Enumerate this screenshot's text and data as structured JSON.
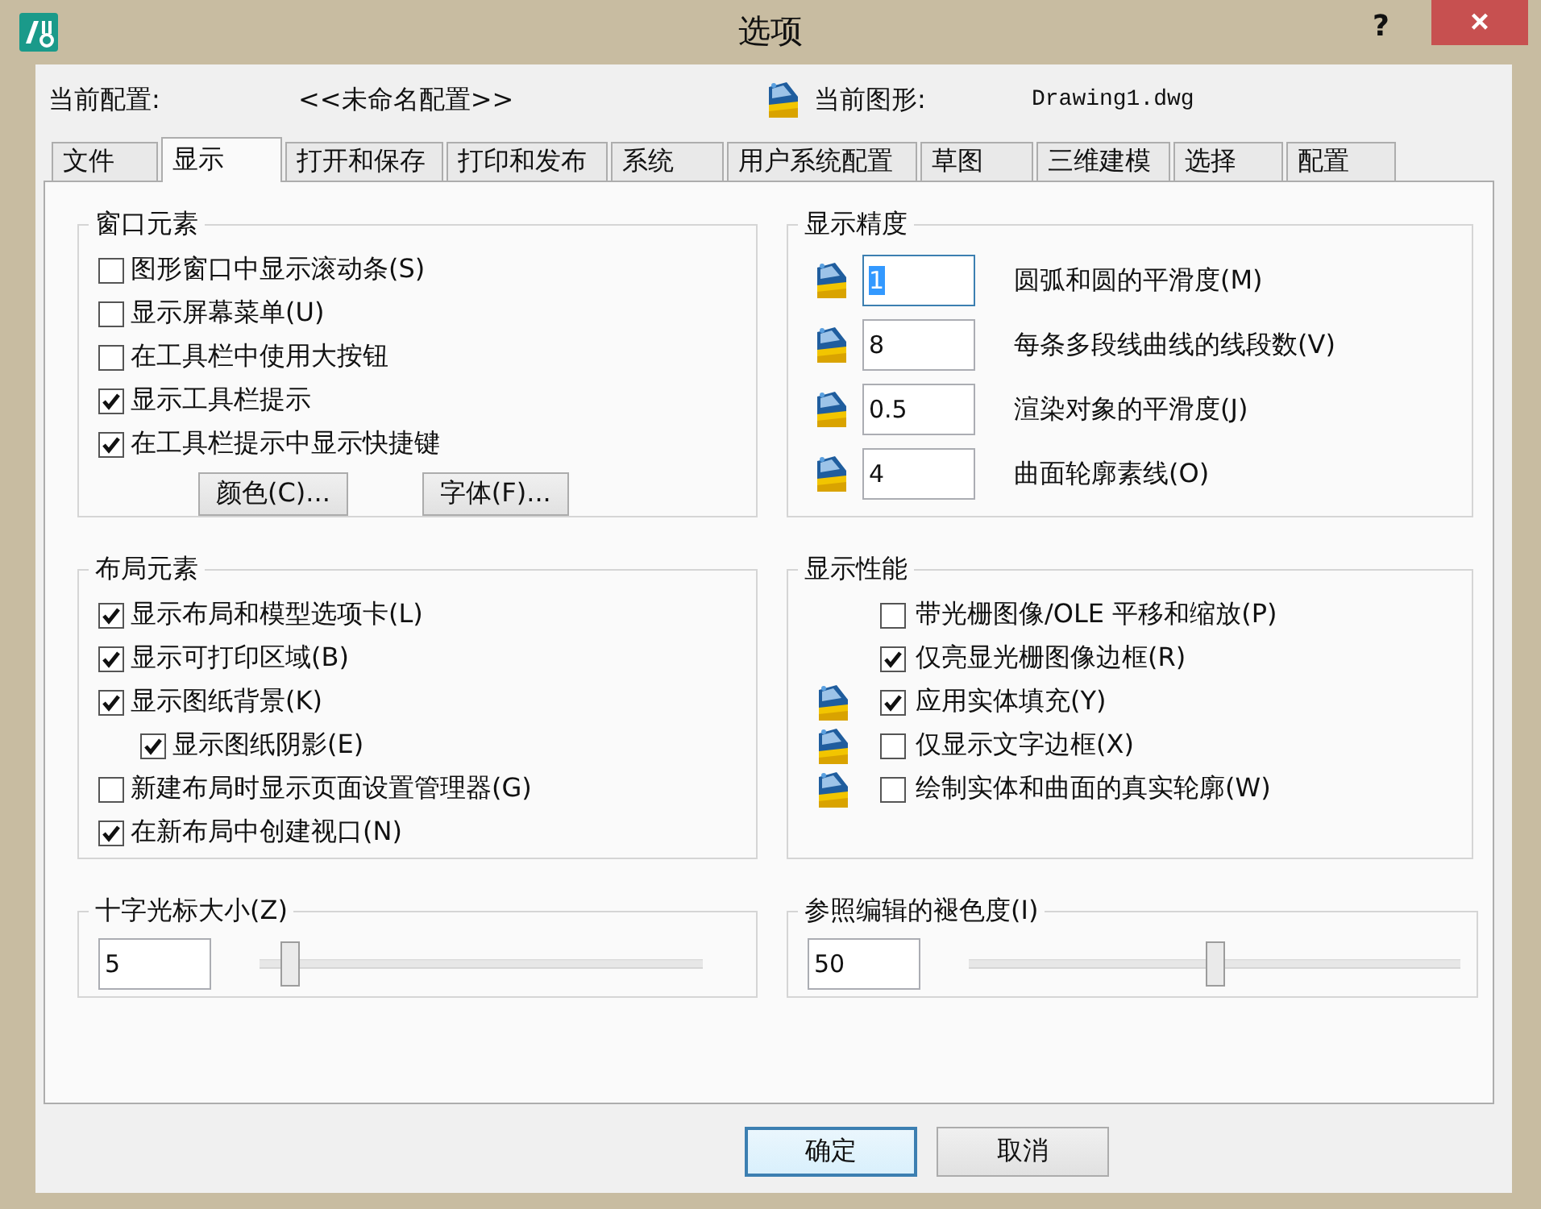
{
  "window": {
    "title": "选项",
    "help": "?",
    "close": "×"
  },
  "header": {
    "profile_label": "当前配置:",
    "profile_value": "<<未命名配置>>",
    "drawing_label": "当前图形:",
    "drawing_value": "Drawing1.dwg"
  },
  "tabs": [
    {
      "label": "文件",
      "selected": false
    },
    {
      "label": "显示",
      "selected": true
    },
    {
      "label": "打开和保存",
      "selected": false
    },
    {
      "label": "打印和发布",
      "selected": false
    },
    {
      "label": "系统",
      "selected": false
    },
    {
      "label": "用户系统配置",
      "selected": false
    },
    {
      "label": "草图",
      "selected": false
    },
    {
      "label": "三维建模",
      "selected": false
    },
    {
      "label": "选择",
      "selected": false
    },
    {
      "label": "配置",
      "selected": false
    }
  ],
  "window_elements": {
    "title": "窗口元素",
    "options": [
      {
        "label": "图形窗口中显示滚动条(S)",
        "checked": false
      },
      {
        "label": "显示屏幕菜单(U)",
        "checked": false
      },
      {
        "label": "在工具栏中使用大按钮",
        "checked": false
      },
      {
        "label": "显示工具栏提示",
        "checked": true
      },
      {
        "label": "在工具栏提示中显示快捷键",
        "checked": true
      }
    ],
    "buttons": [
      "颜色(C)...",
      "字体(F)..."
    ]
  },
  "display_resolution": {
    "title": "显示精度",
    "rows": [
      {
        "value": "1",
        "label": "圆弧和圆的平滑度(M)",
        "focused": true
      },
      {
        "value": "8",
        "label": "每条多段线曲线的线段数(V)",
        "focused": false
      },
      {
        "value": "0.5",
        "label": "渲染对象的平滑度(J)",
        "focused": false
      },
      {
        "value": "4",
        "label": "曲面轮廓素线(O)",
        "focused": false
      }
    ]
  },
  "layout_elements": {
    "title": "布局元素",
    "options": [
      {
        "label": "显示布局和模型选项卡(L)",
        "checked": true
      },
      {
        "label": "显示可打印区域(B)",
        "checked": true
      },
      {
        "label": "显示图纸背景(K)",
        "checked": true,
        "children": [
          {
            "label": "显示图纸阴影(E)",
            "checked": true
          }
        ]
      },
      {
        "label": "新建布局时显示页面设置管理器(G)",
        "checked": false
      },
      {
        "label": "在新布局中创建视口(N)",
        "checked": true
      }
    ]
  },
  "display_performance": {
    "title": "显示性能",
    "options": [
      {
        "label": "带光栅图像/OLE 平移和缩放(P)",
        "checked": false,
        "saved_in_drawing": false
      },
      {
        "label": "仅亮显光栅图像边框(R)",
        "checked": true,
        "saved_in_drawing": false
      },
      {
        "label": "应用实体填充(Y)",
        "checked": true,
        "saved_in_drawing": true
      },
      {
        "label": "仅显示文字边框(X)",
        "checked": false,
        "saved_in_drawing": true
      },
      {
        "label": "绘制实体和曲面的真实轮廓(W)",
        "checked": false,
        "saved_in_drawing": true
      }
    ]
  },
  "crosshair_size": {
    "title": "十字光标大小(Z)",
    "value": "5",
    "level": 0.05
  },
  "xref_fading": {
    "title": "参照编辑的褪色度(I)",
    "value": "50",
    "level": 0.5
  },
  "buttons": [
    {
      "label": "确定",
      "default": true
    },
    {
      "label": "取消",
      "default": false
    }
  ]
}
